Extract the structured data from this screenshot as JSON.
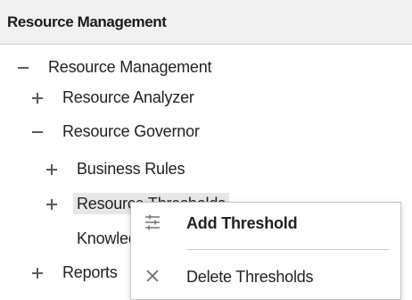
{
  "panel": {
    "title": "Resource Management"
  },
  "tree": {
    "nodes": [
      {
        "label": "Resource Management",
        "state": "expanded"
      },
      {
        "label": "Resource Analyzer",
        "state": "collapsed"
      },
      {
        "label": "Resource Governor",
        "state": "expanded"
      },
      {
        "label": "Business Rules",
        "state": "collapsed"
      },
      {
        "label": "Resource Thresholds",
        "state": "collapsed",
        "selected": true
      },
      {
        "label": "Knowledge Base",
        "state": "leaf"
      },
      {
        "label": "Reports",
        "state": "collapsed"
      }
    ]
  },
  "context_menu": {
    "items": [
      {
        "label": "Add Threshold",
        "icon": "sliders-icon",
        "bold": true
      },
      {
        "label": "Delete Thresholds",
        "icon": "close-icon",
        "bold": false
      }
    ]
  },
  "colors": {
    "header_bg": "#f1f1f1",
    "selected_bg": "#e7e7e7",
    "menu_border": "#c6c6c6",
    "icon_gray": "#5a5a5a"
  }
}
